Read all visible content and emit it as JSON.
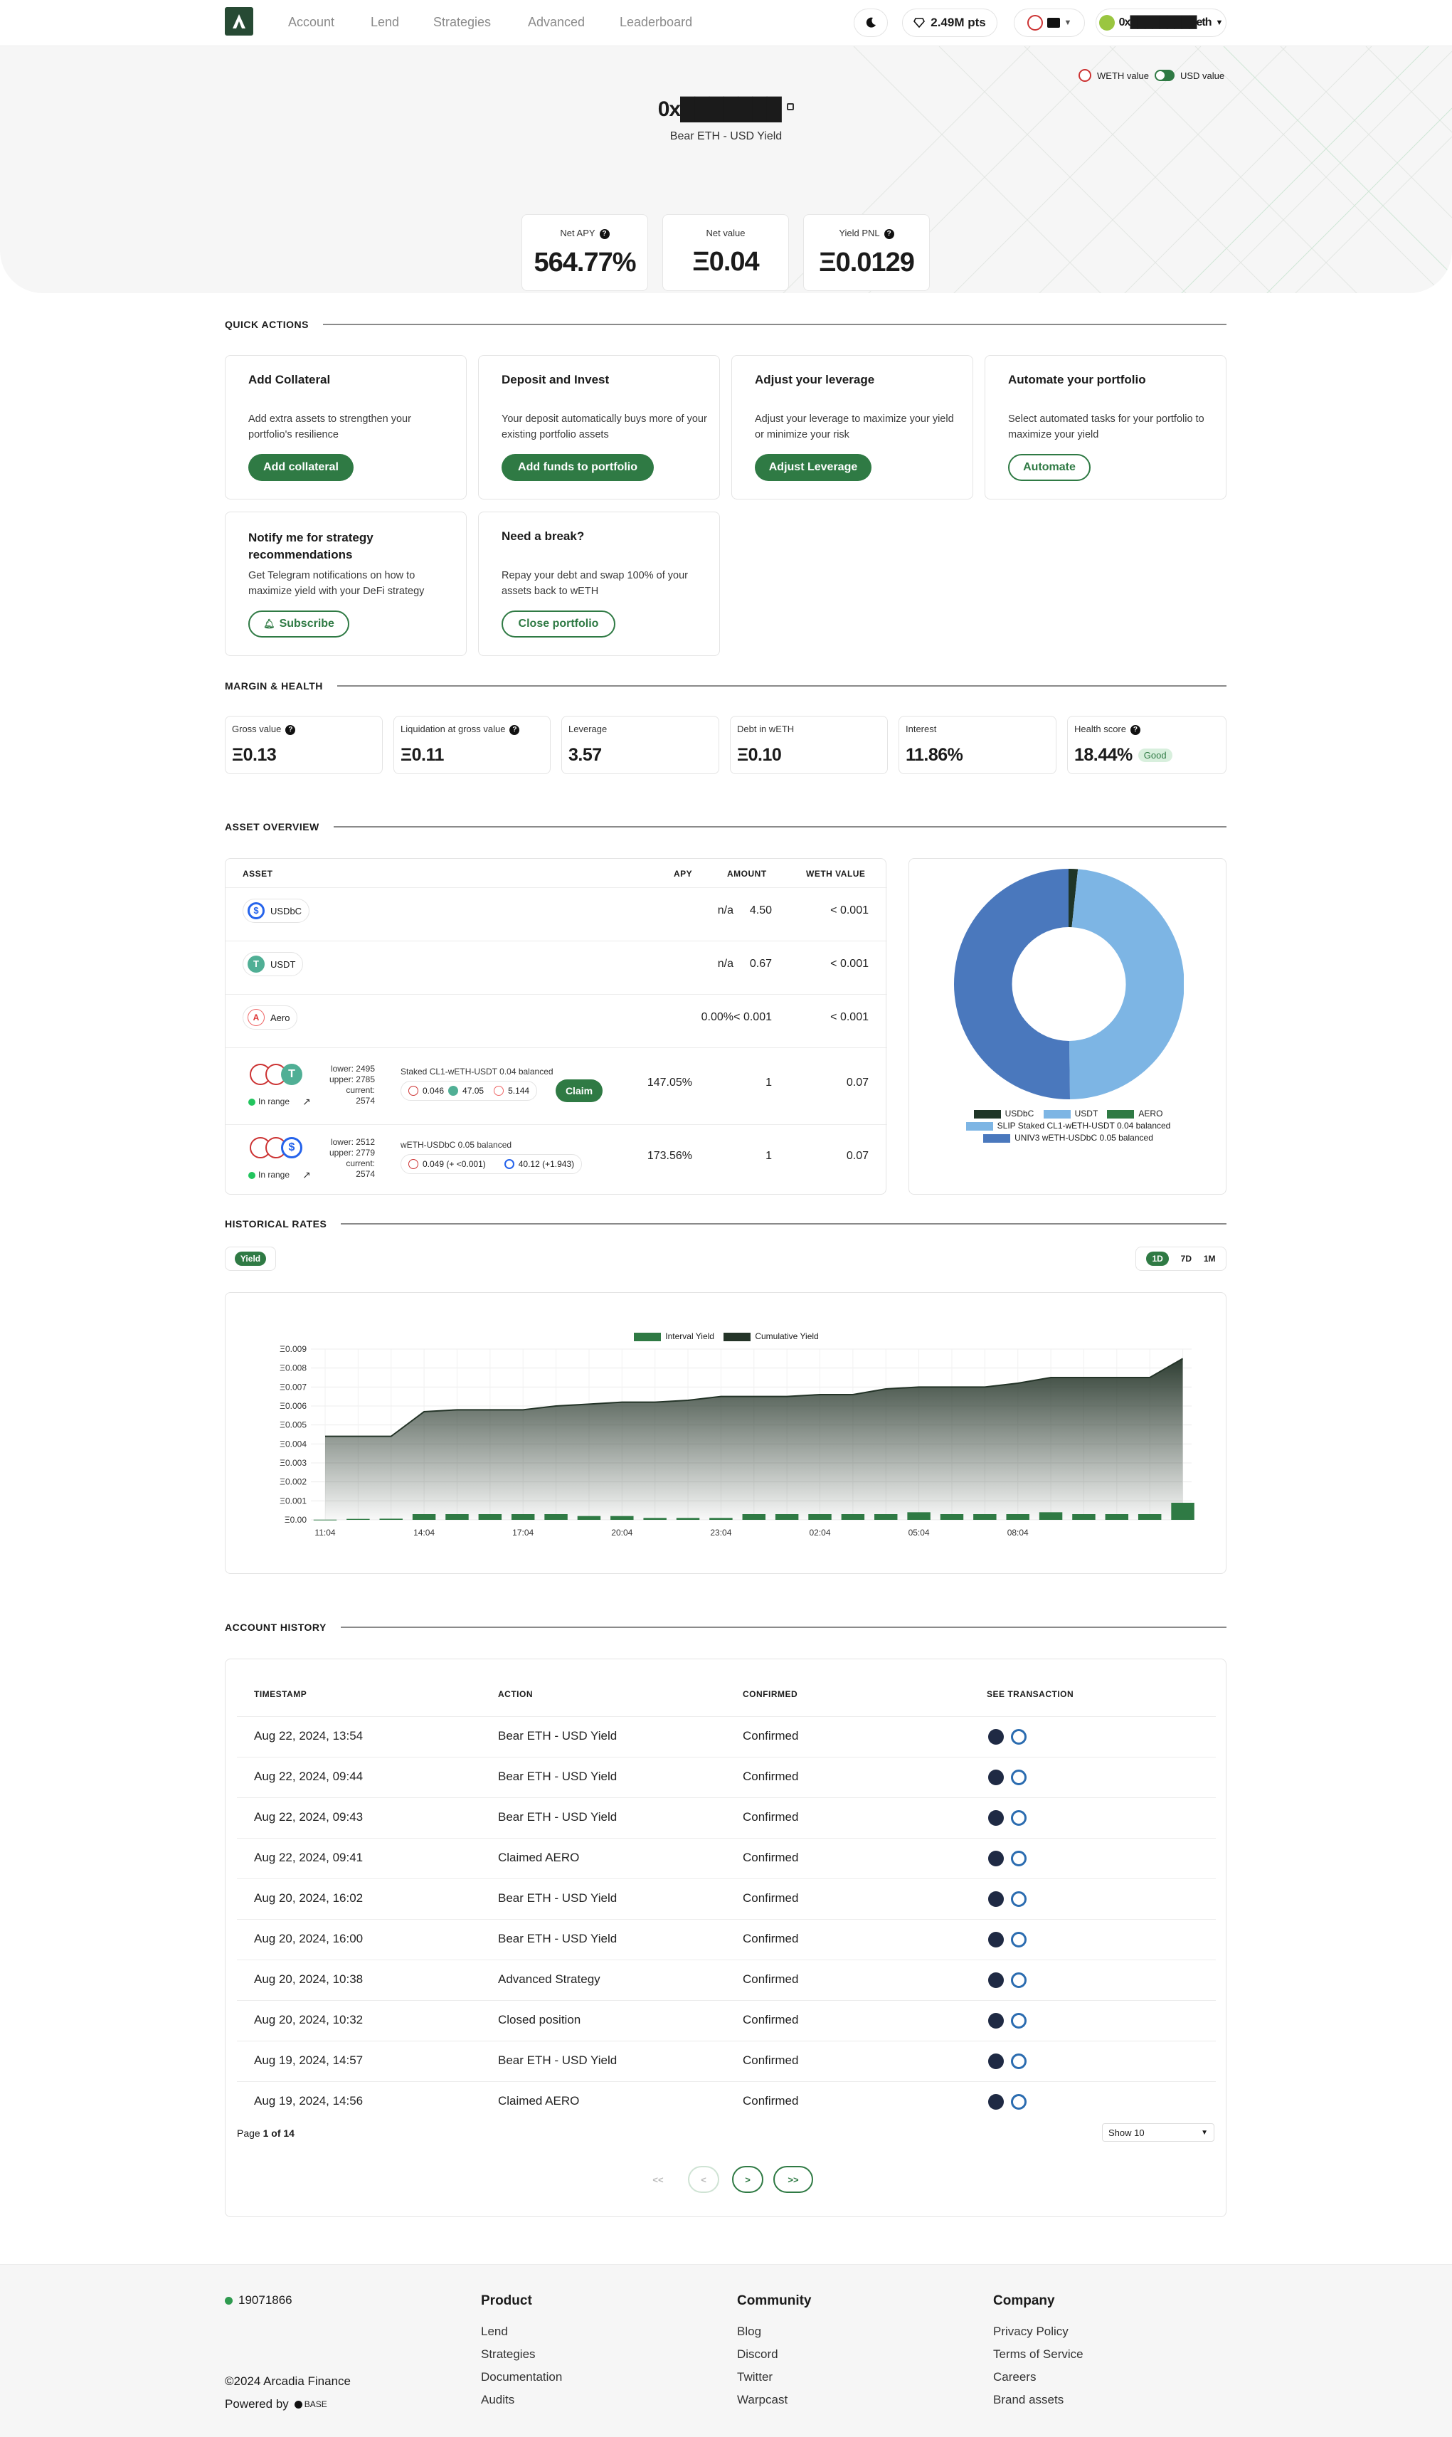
{
  "nav": {
    "links": [
      "Account",
      "Lend",
      "Strategies",
      "Advanced",
      "Leaderboard"
    ],
    "points": "2.49M pts",
    "wallet": "0x█████████eth"
  },
  "hero": {
    "address": "0x███████",
    "subtitle": "Bear ETH - USD Yield",
    "toggle_left": "WETH value",
    "toggle_right": "USD value",
    "stats": [
      {
        "label": "Net APY",
        "value": "564.77%"
      },
      {
        "label": "Net value",
        "value": "Ξ0.04"
      },
      {
        "label": "Yield PNL",
        "value": "Ξ0.0129"
      }
    ]
  },
  "quick_actions": {
    "heading": "QUICK ACTIONS",
    "cards": [
      {
        "title": "Add Collateral",
        "desc": "Add extra assets to strengthen your portfolio's resilience",
        "button": "Add collateral"
      },
      {
        "title": "Deposit and Invest",
        "desc": "Your deposit automatically buys more of your existing portfolio assets",
        "button": "Add funds to portfolio"
      },
      {
        "title": "Adjust your leverage",
        "desc": "Adjust your leverage to maximize your yield or minimize your risk",
        "button": "Adjust Leverage"
      },
      {
        "title": "Automate your portfolio",
        "desc": "Select automated tasks for your portfolio to maximize your yield",
        "button": "Automate"
      },
      {
        "title": "Notify me for strategy recommendations",
        "desc": "Get Telegram notifications on how to maximize yield with your DeFi strategy",
        "button": "Subscribe"
      },
      {
        "title": "Need a break?",
        "desc": "Repay your debt and swap 100% of your assets back to wETH",
        "button": "Close portfolio"
      }
    ]
  },
  "margin": {
    "heading": "MARGIN & HEALTH",
    "items": [
      {
        "label": "Gross value",
        "value": "Ξ0.13"
      },
      {
        "label": "Liquidation at gross value",
        "value": "Ξ0.11"
      },
      {
        "label": "Leverage",
        "value": "3.57"
      },
      {
        "label": "Debt in wETH",
        "value": "Ξ0.10"
      },
      {
        "label": "Interest",
        "value": "11.86%"
      },
      {
        "label": "Health score",
        "value": "18.44%"
      }
    ],
    "health_badge": "Good"
  },
  "assets": {
    "heading": "ASSET OVERVIEW",
    "columns": [
      "ASSET",
      "APY",
      "AMOUNT",
      "WETH VALUE"
    ],
    "rows": [
      {
        "name": "USDbC",
        "apy": "n/a",
        "amount": "4.50",
        "value": "< 0.001"
      },
      {
        "name": "USDT",
        "apy": "n/a",
        "amount": "0.67",
        "value": "< 0.001"
      },
      {
        "name": "Aero",
        "apy": "0.00%",
        "amount": "< 0.001",
        "value": "< 0.001"
      },
      {
        "name": "Staked CL1-wETH-USDT 0.04 balanced",
        "range": [
          "lower: 2495",
          "upper: 2785",
          "current: 2574"
        ],
        "status": "In range",
        "tokens": [
          "0.046",
          "47.05",
          "5.144"
        ],
        "claim": "Claim",
        "apy": "147.05%",
        "amount": "1",
        "value": "0.07"
      },
      {
        "name": "wETH-USDbC 0.05 balanced",
        "range": [
          "lower: 2512",
          "upper: 2779",
          "current: 2574"
        ],
        "status": "In range",
        "tokens": [
          "0.049 (+ <0.001)",
          "40.12 (+1.943)"
        ],
        "apy": "173.56%",
        "amount": "1",
        "value": "0.07"
      }
    ],
    "legend": [
      "USDbC",
      "USDT",
      "AERO",
      "SLIP Staked CL1-wETH-USDT 0.04 balanced",
      "UNIV3 wETH-USDbC 0.05 balanced"
    ]
  },
  "chart_data": {
    "type": "area",
    "title": "",
    "legend": [
      "Interval Yield",
      "Cumulative Yield"
    ],
    "x_tick_labels": [
      "11:04",
      "14:04",
      "17:04",
      "20:04",
      "23:04",
      "02:04",
      "05:04",
      "08:04"
    ],
    "y_tick_labels": [
      "Ξ0.00",
      "Ξ0.001",
      "Ξ0.002",
      "Ξ0.003",
      "Ξ0.004",
      "Ξ0.005",
      "Ξ0.006",
      "Ξ0.007",
      "Ξ0.008",
      "Ξ0.009"
    ],
    "ylim": [
      0,
      0.009
    ],
    "cumulative": [
      0.0044,
      0.0044,
      0.0044,
      0.0057,
      0.0058,
      0.0058,
      0.0058,
      0.006,
      0.0061,
      0.0062,
      0.0062,
      0.0063,
      0.0065,
      0.0065,
      0.0065,
      0.0066,
      0.0066,
      0.0069,
      0.007,
      0.007,
      0.007,
      0.0072,
      0.0075,
      0.0075,
      0.0075,
      0.0075,
      0.0085
    ],
    "interval": [
      1e-05,
      5e-05,
      6e-05,
      0.0003,
      0.0003,
      0.0003,
      0.0003,
      0.0003,
      0.0002,
      0.0002,
      0.0001,
      0.0001,
      0.0001,
      0.0003,
      0.0003,
      0.0003,
      0.0003,
      0.0003,
      0.0004,
      0.0003,
      0.0003,
      0.0003,
      0.0004,
      0.0003,
      0.0003,
      0.0003,
      0.0009
    ],
    "colors": {
      "interval": "#2f7a44",
      "cumulative": "#243428"
    }
  },
  "historical": {
    "heading": "HISTORICAL RATES",
    "tab": "Yield",
    "ranges": [
      "1D",
      "7D",
      "1M"
    ]
  },
  "history": {
    "heading": "ACCOUNT HISTORY",
    "columns": [
      "TIMESTAMP",
      "ACTION",
      "CONFIRMED",
      "SEE TRANSACTION"
    ],
    "rows": [
      {
        "time": "Aug 22, 2024, 13:54",
        "action": "Bear ETH - USD Yield",
        "status": "Confirmed"
      },
      {
        "time": "Aug 22, 2024, 09:44",
        "action": "Bear ETH - USD Yield",
        "status": "Confirmed"
      },
      {
        "time": "Aug 22, 2024, 09:43",
        "action": "Bear ETH - USD Yield",
        "status": "Confirmed"
      },
      {
        "time": "Aug 22, 2024, 09:41",
        "action": "Claimed AERO",
        "status": "Confirmed"
      },
      {
        "time": "Aug 20, 2024, 16:02",
        "action": "Bear ETH - USD Yield",
        "status": "Confirmed"
      },
      {
        "time": "Aug 20, 2024, 16:00",
        "action": "Bear ETH - USD Yield",
        "status": "Confirmed"
      },
      {
        "time": "Aug 20, 2024, 10:38",
        "action": "Advanced Strategy",
        "status": "Confirmed"
      },
      {
        "time": "Aug 20, 2024, 10:32",
        "action": "Closed position",
        "status": "Confirmed"
      },
      {
        "time": "Aug 19, 2024, 14:57",
        "action": "Bear ETH - USD Yield",
        "status": "Confirmed"
      },
      {
        "time": "Aug 19, 2024, 14:56",
        "action": "Claimed AERO",
        "status": "Confirmed"
      }
    ],
    "page_prefix": "Page ",
    "page_current": "1 of 14",
    "page_size": "Show 10",
    "pager": [
      "<<",
      "<",
      ">",
      ">>"
    ]
  },
  "footer": {
    "block": "19071866",
    "copyright": "©2024 Arcadia Finance",
    "powered": "Powered by",
    "powered_brand": "BASE",
    "product": {
      "title": "Product",
      "links": [
        "Lend",
        "Strategies",
        "Documentation",
        "Audits"
      ]
    },
    "community": {
      "title": "Community",
      "links": [
        "Blog",
        "Discord",
        "Twitter",
        "Warpcast"
      ]
    },
    "company": {
      "title": "Company",
      "links": [
        "Privacy Policy",
        "Terms of Service",
        "Careers",
        "Brand assets"
      ]
    }
  }
}
